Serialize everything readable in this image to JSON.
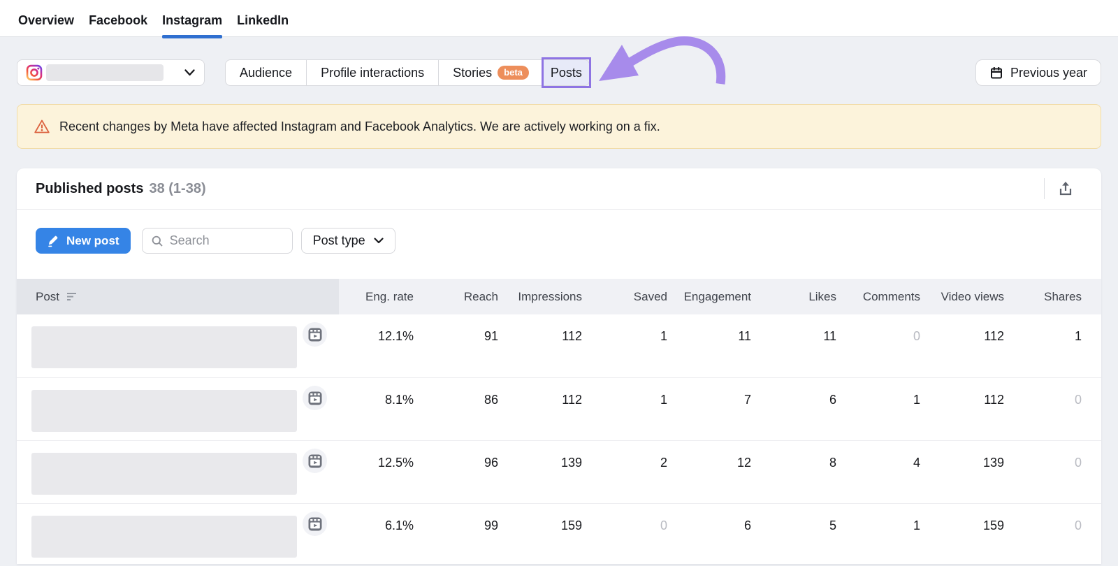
{
  "nav": {
    "tabs": [
      {
        "label": "Overview"
      },
      {
        "label": "Facebook"
      },
      {
        "label": "Instagram"
      },
      {
        "label": "LinkedIn"
      }
    ],
    "active": "Instagram"
  },
  "controls": {
    "segments": [
      "Audience",
      "Profile interactions",
      "Stories",
      "Posts"
    ],
    "beta_label": "beta",
    "selected": "Posts",
    "date_button": "Previous year"
  },
  "banner": {
    "text": "Recent changes by Meta have affected Instagram and Facebook Analytics. We are actively working on a fix."
  },
  "card": {
    "title": "Published posts",
    "count": "38 (1-38)"
  },
  "toolbar": {
    "new_post": "New post",
    "search_placeholder": "Search",
    "post_type": "Post type"
  },
  "table": {
    "columns": [
      "Post",
      "Eng. rate",
      "Reach",
      "Impressions",
      "Saved",
      "Engagement",
      "Likes",
      "Comments",
      "Video views",
      "Shares"
    ],
    "rows": [
      {
        "values": [
          "12.1%",
          "91",
          "112",
          "1",
          "11",
          "11",
          "0",
          "112",
          "1"
        ]
      },
      {
        "values": [
          "8.1%",
          "86",
          "112",
          "1",
          "7",
          "6",
          "1",
          "112",
          "0"
        ]
      },
      {
        "values": [
          "12.5%",
          "96",
          "139",
          "2",
          "12",
          "8",
          "4",
          "139",
          "0"
        ]
      },
      {
        "values": [
          "6.1%",
          "99",
          "159",
          "0",
          "6",
          "5",
          "1",
          "159",
          "0"
        ]
      }
    ]
  },
  "colors": {
    "accent_blue": "#3584E6",
    "tab_underline": "#2F6FD0",
    "annotation_purple": "#8E74E3",
    "arrow_purple": "#A78BEB",
    "beta_badge": "#ED8E5B",
    "banner_bg": "#FCF3DB",
    "warning_icon": "#DC6340"
  }
}
